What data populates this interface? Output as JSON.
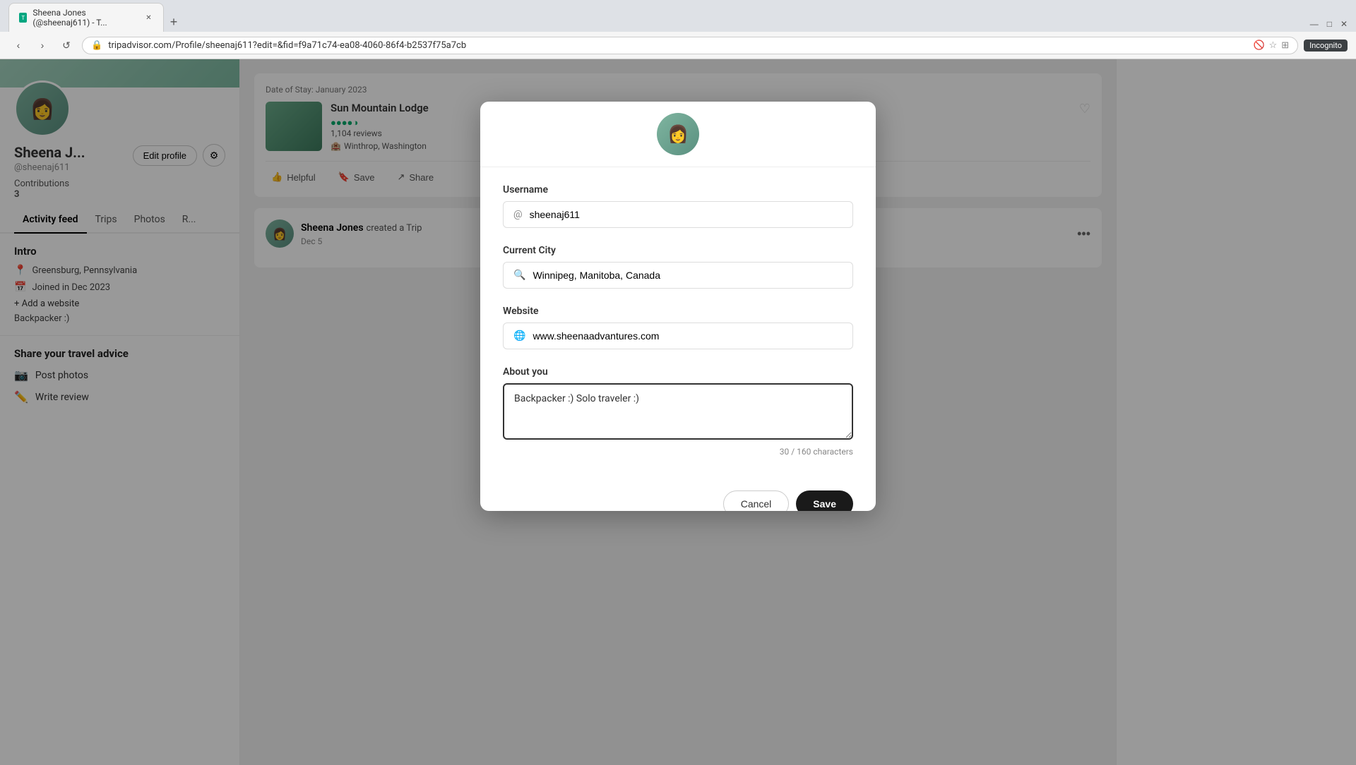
{
  "browser": {
    "tab_title": "Sheena Jones (@sheenaj611) - T...",
    "url": "tripadvisor.com/Profile/sheenaj611?edit=&fid=f9a71c74-ea08-4060-86f4-b2537f75a7cb",
    "favicon_letter": "T",
    "incognito_label": "Incognito"
  },
  "profile": {
    "name": "Sheena J...",
    "handle": "@sheenaj611",
    "contributions_label": "Contributions",
    "contributions_count": "3",
    "edit_profile_label": "Edit profile",
    "avatar_emoji": "👩",
    "nav_items": [
      {
        "label": "Activity feed",
        "active": true
      },
      {
        "label": "Trips"
      },
      {
        "label": "Photos"
      },
      {
        "label": "R..."
      }
    ]
  },
  "intro": {
    "title": "Intro",
    "location": "Greensburg, Pennsylvania",
    "joined": "Joined in Dec 2023",
    "add_website_label": "+ Add a website",
    "bio": "Backpacker :)"
  },
  "share_section": {
    "title": "Share your travel advice",
    "post_photos_label": "Post photos",
    "write_review_label": "Write review"
  },
  "modal": {
    "username_label": "Username",
    "username_prefix": "@",
    "username_value": "sheenaj611",
    "current_city_label": "Current City",
    "current_city_value": "Winnipeg, Manitoba, Canada",
    "website_label": "Website",
    "website_value": "www.sheenaadvantures.com",
    "about_label": "About you",
    "about_value": "Backpacker :) Solo traveler :)",
    "char_count": "30 / 160 characters",
    "cancel_label": "Cancel",
    "save_label": "Save"
  },
  "feed": {
    "date_of_stay_label": "Date of Stay: January 2023",
    "lodge": {
      "name": "Sun Mountain Lodge",
      "stars": "●●●●◑",
      "reviews": "1,104 reviews",
      "location": "Winthrop, Washington"
    },
    "actions": {
      "helpful": "Helpful",
      "save": "Save",
      "share": "Share"
    },
    "second_entry": {
      "username": "Sheena Jones",
      "action": "created a Trip",
      "date": "Dec 5"
    }
  }
}
